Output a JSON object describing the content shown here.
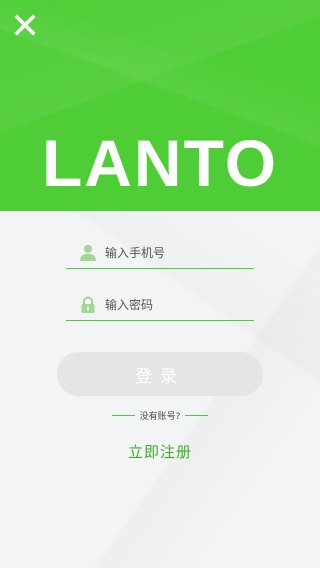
{
  "brand": {
    "logo": "LANTO",
    "accent_color": "#4fcd36"
  },
  "close": {
    "icon": "close-icon"
  },
  "form": {
    "phone": {
      "placeholder": "输入手机号",
      "value": "",
      "icon": "user-icon"
    },
    "password": {
      "placeholder": "输入密码",
      "value": "",
      "icon": "lock-icon"
    },
    "login_label": "登录"
  },
  "signup": {
    "prompt": "没有账号?",
    "register_label": "立即注册"
  }
}
